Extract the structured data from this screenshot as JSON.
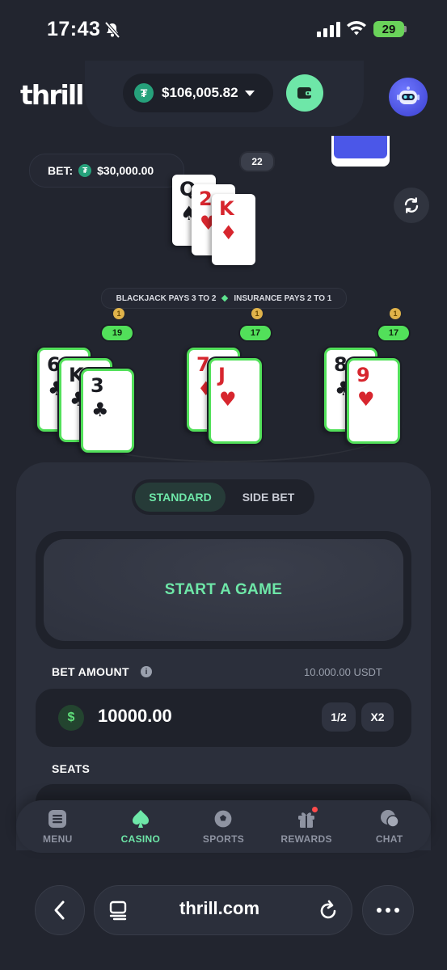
{
  "status_bar": {
    "time": "17:43",
    "battery": "29"
  },
  "header": {
    "logo": "thrill",
    "balance": "$106,005.82",
    "currency_icon": "tether-icon"
  },
  "game": {
    "bet_label": "BET:",
    "bet_value": "$30,000.00",
    "dealer_score": "22",
    "dealer_cards": [
      {
        "rank": "Q",
        "suit": "♠",
        "color": "black"
      },
      {
        "rank": "2",
        "suit": "♥",
        "color": "red"
      },
      {
        "rank": "K",
        "suit": "♦",
        "color": "red"
      }
    ],
    "rules_left": "BLACKJACK PAYS 3 TO 2",
    "rules_right": "INSURANCE PAYS 2 TO 1",
    "hands": [
      {
        "medal": "1",
        "score": "19",
        "cards": [
          {
            "rank": "6",
            "suit": "♣"
          },
          {
            "rank": "K",
            "suit": "♣"
          },
          {
            "rank": "3",
            "suit": "♣"
          }
        ]
      },
      {
        "medal": "1",
        "score": "17",
        "cards": [
          {
            "rank": "7",
            "suit": "♦"
          },
          {
            "rank": "J",
            "suit": "♥"
          }
        ]
      },
      {
        "medal": "1",
        "score": "17",
        "cards": [
          {
            "rank": "8",
            "suit": "♣"
          },
          {
            "rank": "9",
            "suit": "♥"
          }
        ]
      }
    ]
  },
  "panel": {
    "tabs": [
      "STANDARD",
      "SIDE BET"
    ],
    "start_label": "START A GAME",
    "bet_amount_label": "BET AMOUNT",
    "bet_amount_usdt": "10.000.00 USDT",
    "amount_value": "10000.00",
    "half_label": "1/2",
    "double_label": "X2",
    "seats_label": "SEATS"
  },
  "nav": {
    "items": [
      "MENU",
      "CASINO",
      "SPORTS",
      "REWARDS",
      "CHAT"
    ]
  },
  "browser": {
    "url": "thrill.com"
  },
  "colors": {
    "accent": "#6ee7a8",
    "win_green": "#52e05a",
    "bg": "#22252f",
    "panel": "#2b2f3b"
  }
}
